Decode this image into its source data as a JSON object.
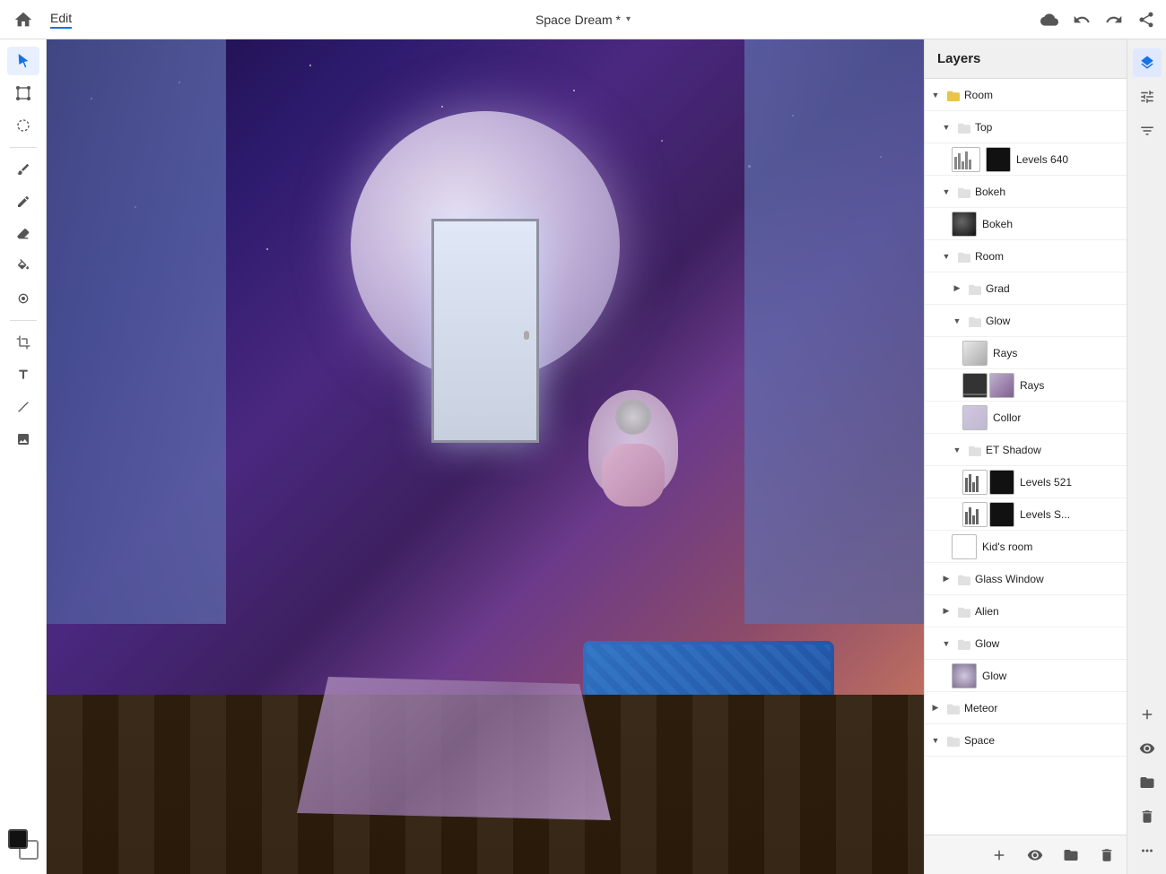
{
  "topbar": {
    "home_title": "Home",
    "edit_label": "Edit",
    "doc_title": "Space Dream *",
    "chevron": "▾"
  },
  "layers_panel": {
    "title": "Layers",
    "items": [
      {
        "id": "room-group",
        "name": "Room",
        "type": "group",
        "indent": 0,
        "expanded": true,
        "eye": "visible",
        "eye_hidden": false
      },
      {
        "id": "top-group",
        "name": "Top",
        "type": "group",
        "indent": 1,
        "expanded": true,
        "eye": "visible",
        "eye_hidden": false
      },
      {
        "id": "levels640",
        "name": "Levels 640",
        "type": "layer",
        "indent": 2,
        "thumb": "levels",
        "eye": "visible",
        "eye_hidden": false
      },
      {
        "id": "bokeh-group",
        "name": "Bokeh",
        "type": "group",
        "indent": 1,
        "expanded": true,
        "eye": "visible",
        "eye_hidden": false
      },
      {
        "id": "bokeh-layer",
        "name": "Bokeh",
        "type": "layer",
        "indent": 2,
        "thumb": "bokeh",
        "eye": "visible",
        "eye_hidden": false
      },
      {
        "id": "room-group2",
        "name": "Room",
        "type": "group",
        "indent": 1,
        "expanded": true,
        "eye": "visible",
        "eye_hidden": false
      },
      {
        "id": "grad-group",
        "name": "Grad",
        "type": "group",
        "indent": 2,
        "expanded": false,
        "eye": "visible",
        "eye_hidden": false
      },
      {
        "id": "glow-group",
        "name": "Glow",
        "type": "group",
        "indent": 2,
        "expanded": true,
        "eye": "visible",
        "eye_hidden": false
      },
      {
        "id": "rays-layer",
        "name": "Rays",
        "type": "layer",
        "indent": 3,
        "thumb": "rays",
        "eye": "visible",
        "eye_hidden": false
      },
      {
        "id": "rays-layer2",
        "name": "Rays",
        "type": "layer",
        "indent": 3,
        "thumb": "rays2",
        "eye": "visible",
        "eye_hidden": false
      },
      {
        "id": "collor-layer",
        "name": "Collor",
        "type": "layer",
        "indent": 3,
        "thumb": "collor",
        "eye": "visible",
        "eye_hidden": false
      },
      {
        "id": "etshadow-group",
        "name": "ET Shadow",
        "type": "group",
        "indent": 2,
        "expanded": true,
        "eye": "visible",
        "eye_hidden": true
      },
      {
        "id": "levels521",
        "name": "Levels 521",
        "type": "layer",
        "indent": 3,
        "thumb": "levels521",
        "eye": "visible",
        "eye_hidden": true
      },
      {
        "id": "levelss",
        "name": "Levels S...",
        "type": "layer",
        "indent": 3,
        "thumb": "levelss",
        "eye": "visible",
        "eye_hidden": true
      },
      {
        "id": "kidsroom",
        "name": "Kid's room",
        "type": "layer",
        "indent": 2,
        "thumb": "kidroom",
        "eye": "visible",
        "eye_hidden": false
      },
      {
        "id": "glasswindow-group",
        "name": "Glass Window",
        "type": "group",
        "indent": 1,
        "expanded": false,
        "eye": "visible",
        "eye_hidden": false
      },
      {
        "id": "alien-group",
        "name": "Alien",
        "type": "group",
        "indent": 1,
        "expanded": false,
        "eye": "visible",
        "eye_hidden": false
      },
      {
        "id": "glow-group2",
        "name": "Glow",
        "type": "group",
        "indent": 1,
        "expanded": true,
        "eye": "visible",
        "eye_hidden": false
      },
      {
        "id": "glow-layer2",
        "name": "Glow",
        "type": "layer",
        "indent": 2,
        "thumb": "glow",
        "eye": "visible",
        "eye_hidden": false
      },
      {
        "id": "meteor-group",
        "name": "Meteor",
        "type": "group",
        "indent": 0,
        "expanded": false,
        "eye": "visible",
        "eye_hidden": false
      },
      {
        "id": "space-group",
        "name": "Space",
        "type": "group",
        "indent": 0,
        "expanded": true,
        "eye": "visible",
        "eye_hidden": false
      }
    ]
  },
  "right_tools": [
    {
      "name": "layers-icon",
      "label": "▤",
      "active": false
    },
    {
      "name": "adjust-icon",
      "label": "⊞",
      "active": true
    },
    {
      "name": "filters-icon",
      "label": "≡",
      "active": false
    }
  ],
  "layer_actions": [
    {
      "name": "add-layer-btn",
      "label": "+"
    },
    {
      "name": "eye-btn",
      "label": "👁"
    },
    {
      "name": "folder-btn",
      "label": "📁"
    },
    {
      "name": "delete-btn",
      "label": "🗑"
    },
    {
      "name": "more-btn",
      "label": "•••"
    }
  ]
}
